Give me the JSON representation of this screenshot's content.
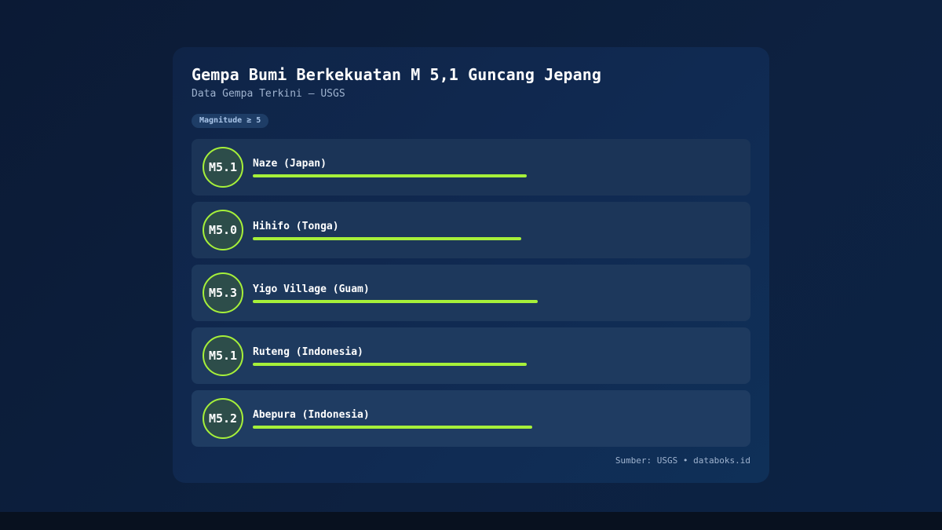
{
  "header": {
    "title": "Gempa Bumi Berkekuatan M 5,1 Guncang Jepang",
    "subtitle": "Data Gempa Terkini — USGS",
    "badge": "Magnitude ≥ 5"
  },
  "footer": {
    "source": "Sumber: USGS • databoks.id"
  },
  "colors": {
    "accent": "#a6f03a",
    "background": "#0b1a35",
    "card": "#102a52"
  },
  "chart_data": {
    "type": "bar",
    "title": "Gempa Bumi Berkekuatan M 5,1 Guncang Jepang",
    "subtitle": "Data Gempa Terkini — USGS",
    "categories": [
      "Naze (Japan)",
      "Hihifo (Tonga)",
      "Yigo Village (Guam)",
      "Ruteng (Indonesia)",
      "Abepura (Indonesia)"
    ],
    "labels": [
      "M5.1",
      "M5.0",
      "M5.3",
      "M5.1",
      "M5.2"
    ],
    "values": [
      5.1,
      5.0,
      5.3,
      5.1,
      5.2
    ],
    "value_max": 7.6,
    "orientation": "horizontal"
  }
}
